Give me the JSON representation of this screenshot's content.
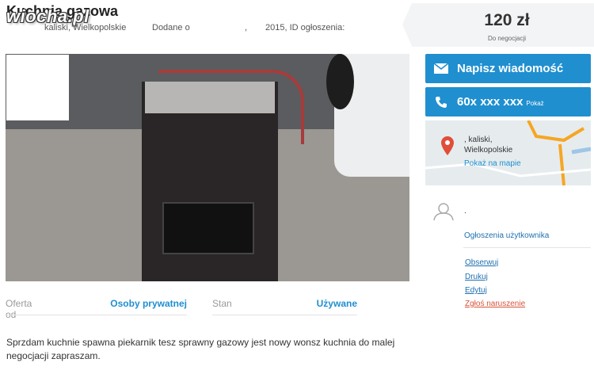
{
  "header": {
    "title": "Kuchnia gazowa",
    "watermark": "wiocha.pl",
    "location": "kaliski, Wielkopolskie",
    "added_prefix": "Dodane o",
    "comma": ",",
    "year_id": "2015, ID ogłoszenia:"
  },
  "price": {
    "value": "120 zł",
    "note": "Do negocjacji"
  },
  "actions": {
    "message_label": "Napisz wiadomość",
    "phone_label": "60x xxx xxx",
    "phone_show": "Pokaż"
  },
  "map": {
    "location_line1": ", kaliski,",
    "location_line2": "Wielkopolskie",
    "link": "Pokaż na mapie"
  },
  "user": {
    "name": ".",
    "ads_link": "Ogłoszenia użytkownika"
  },
  "links": [
    "Obserwuj",
    "Drukuj",
    "Edytuj",
    "Zgłoś naruszenie"
  ],
  "params": [
    {
      "label": "Oferta od",
      "value": "Osoby prywatnej"
    },
    {
      "label": "Stan",
      "value": "Używane"
    }
  ],
  "description": "Sprzdam kuchnie spawna piekarnik tesz sprawny gazowy jest nowy wonsz kuchnia do malej negocjacji zapraszam.",
  "colors": {
    "accent": "#1f8fd0",
    "report": "#d9533a"
  }
}
